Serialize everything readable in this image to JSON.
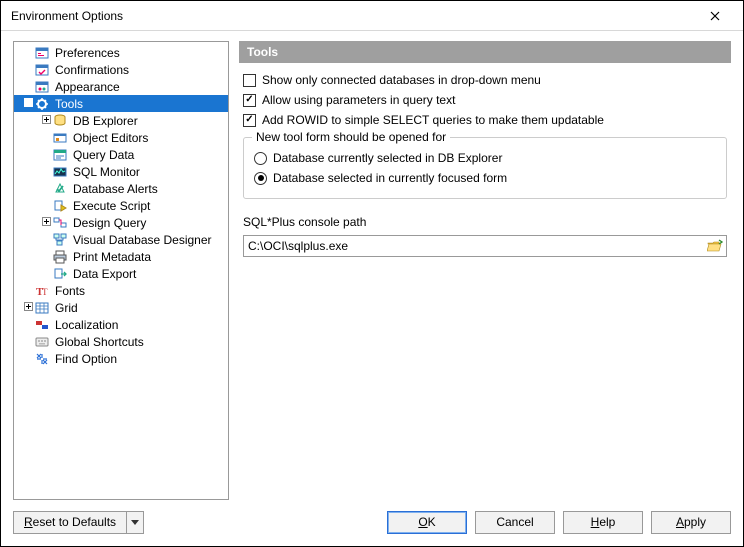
{
  "window": {
    "title": "Environment Options"
  },
  "tree": {
    "items": [
      {
        "label": "Preferences",
        "icon": "pref",
        "indent": 0,
        "exp": "",
        "sel": false
      },
      {
        "label": "Confirmations",
        "icon": "confirm",
        "indent": 0,
        "exp": "",
        "sel": false
      },
      {
        "label": "Appearance",
        "icon": "appearance",
        "indent": 0,
        "exp": "",
        "sel": false
      },
      {
        "label": "Tools",
        "icon": "tools",
        "indent": 0,
        "exp": "−",
        "sel": true
      },
      {
        "label": "DB Explorer",
        "icon": "dbexp",
        "indent": 1,
        "exp": "+",
        "sel": false
      },
      {
        "label": "Object Editors",
        "icon": "objed",
        "indent": 1,
        "exp": "",
        "sel": false
      },
      {
        "label": "Query Data",
        "icon": "query",
        "indent": 1,
        "exp": "",
        "sel": false
      },
      {
        "label": "SQL Monitor",
        "icon": "sqlmon",
        "indent": 1,
        "exp": "",
        "sel": false
      },
      {
        "label": "Database Alerts",
        "icon": "alerts",
        "indent": 1,
        "exp": "",
        "sel": false
      },
      {
        "label": "Execute Script",
        "icon": "exec",
        "indent": 1,
        "exp": "",
        "sel": false
      },
      {
        "label": "Design Query",
        "icon": "design",
        "indent": 1,
        "exp": "+",
        "sel": false
      },
      {
        "label": "Visual Database Designer",
        "icon": "visual",
        "indent": 1,
        "exp": "",
        "sel": false
      },
      {
        "label": "Print Metadata",
        "icon": "print",
        "indent": 1,
        "exp": "",
        "sel": false
      },
      {
        "label": "Data Export",
        "icon": "export",
        "indent": 1,
        "exp": "",
        "sel": false
      },
      {
        "label": "Fonts",
        "icon": "fonts",
        "indent": 0,
        "exp": "",
        "sel": false
      },
      {
        "label": "Grid",
        "icon": "grid",
        "indent": 0,
        "exp": "+",
        "sel": false
      },
      {
        "label": "Localization",
        "icon": "local",
        "indent": 0,
        "exp": "",
        "sel": false
      },
      {
        "label": "Global Shortcuts",
        "icon": "shortcuts",
        "indent": 0,
        "exp": "",
        "sel": false
      },
      {
        "label": "Find Option",
        "icon": "find",
        "indent": 0,
        "exp": "",
        "sel": false
      }
    ]
  },
  "panel": {
    "title": "Tools",
    "checks": [
      {
        "label": "Show only connected databases in drop-down menu",
        "checked": false
      },
      {
        "label": "Allow using parameters in query text",
        "checked": true
      },
      {
        "label": "Add ROWID to simple SELECT queries to make them updatable",
        "checked": true
      }
    ],
    "group": {
      "title": "New tool form should be opened for",
      "radios": [
        {
          "label": "Database currently selected in DB Explorer",
          "selected": false
        },
        {
          "label": "Database selected in currently focused form",
          "selected": true
        }
      ]
    },
    "pathLabel": "SQL*Plus console path",
    "pathValue": "C:\\OCI\\sqlplus.exe"
  },
  "buttons": {
    "reset": "Reset to Defaults",
    "ok": "OK",
    "cancel": "Cancel",
    "help": "Help",
    "apply": "Apply"
  }
}
